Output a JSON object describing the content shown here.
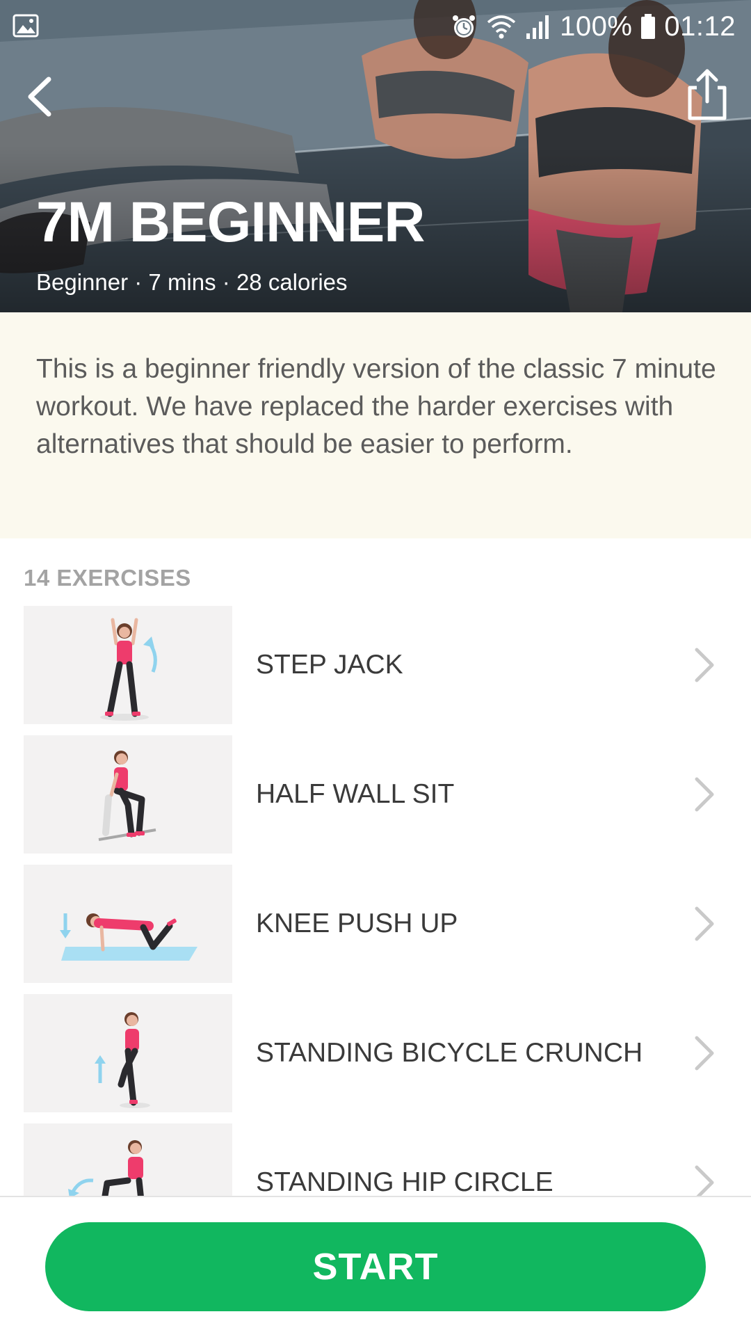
{
  "status_bar": {
    "battery": "100%",
    "time": "01:12",
    "icons": [
      "gallery-icon",
      "alarm-icon",
      "wifi-icon",
      "signal-icon",
      "battery-icon"
    ]
  },
  "nav": {
    "back_icon": "chevron-left-icon",
    "share_icon": "share-icon"
  },
  "workout": {
    "title": "7M BEGINNER",
    "meta": "Beginner · 7 mins · 28 calories",
    "description": "This is a beginner friendly version of the classic 7 minute workout. We have replaced the harder exercises with alternatives that should be easier to perform."
  },
  "exercises": {
    "header": "14 EXERCISES",
    "items": [
      {
        "name": "STEP JACK"
      },
      {
        "name": "HALF WALL SIT"
      },
      {
        "name": "KNEE PUSH UP"
      },
      {
        "name": "STANDING BICYCLE CRUNCH"
      },
      {
        "name": "STANDING HIP CIRCLE"
      }
    ]
  },
  "actions": {
    "start_label": "START"
  },
  "colors": {
    "accent": "#11b75f",
    "description_bg": "#fbf9ee",
    "figure_top": "#ee3c6c",
    "hint_arrow": "#8fd3ee"
  }
}
